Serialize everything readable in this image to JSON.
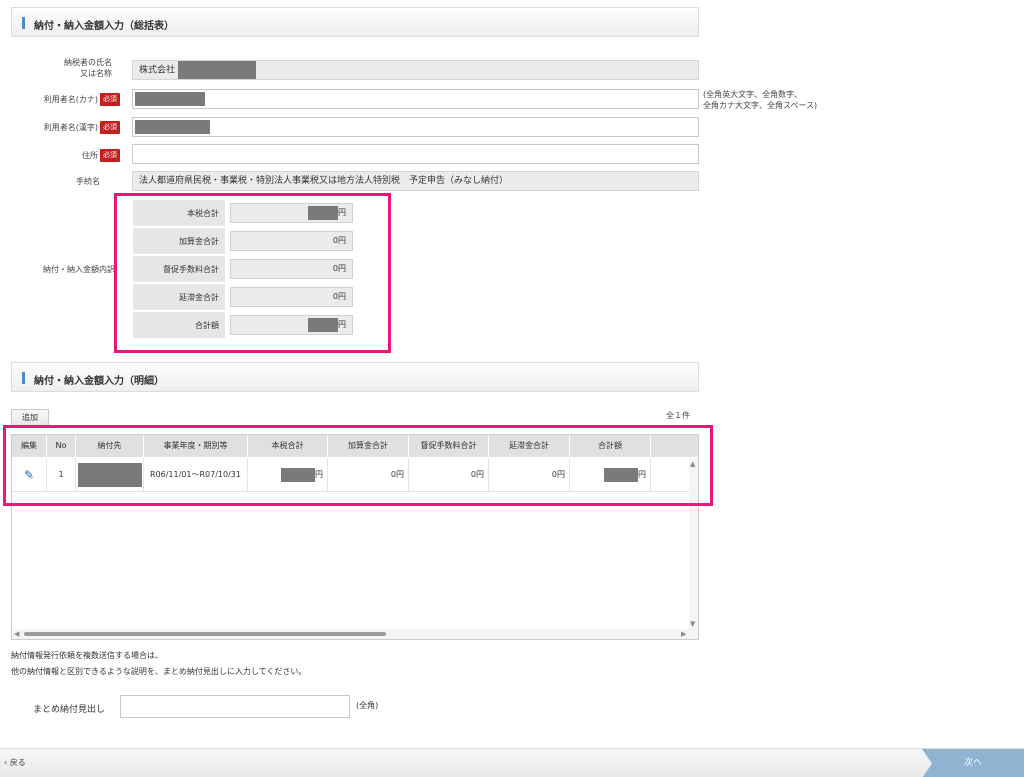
{
  "summary_section": {
    "title": "納付・納入金額入力（総括表）",
    "taxpayer_label": "納税者の氏名\n又は名称",
    "taxpayer_value": "株式会社",
    "user_kana_label": "利用者名(カナ)",
    "user_kanji_label": "利用者名(漢字)",
    "address_label": "住所",
    "required_badge": "必須",
    "kana_note_line1": "(全角英大文字、全角数字、",
    "kana_note_line2": "全角カナ大文字、全角スペース)",
    "procedure_label": "手続名",
    "procedure_value": "法人都道府県民税・事業税・特別法人事業税又は地方法人特別税　予定申告（みなし納付）",
    "breakdown_label": "納付・納入金額内訳",
    "breakdown": [
      {
        "label": "本税合計",
        "value": "円"
      },
      {
        "label": "加算金合計",
        "value": "0円"
      },
      {
        "label": "督促手数料合計",
        "value": "0円"
      },
      {
        "label": "延滞金合計",
        "value": "0円"
      },
      {
        "label": "合計額",
        "value": "円"
      }
    ]
  },
  "detail_section": {
    "title": "納付・納入金額入力（明細）",
    "add_button": "追加",
    "count_text": "全１件",
    "columns": [
      "編集",
      "No",
      "納付先",
      "事業年度・期別等",
      "本税合計",
      "加算金合計",
      "督促手数料合計",
      "延滞金合計",
      "合計額"
    ],
    "rows": [
      {
        "no": "1",
        "period": "R06/11/01～R07/10/31",
        "main_tax": "円",
        "addition": "0円",
        "fee": "0円",
        "delay": "0円",
        "total": "円"
      }
    ],
    "info_line1": "納付情報発行依頼を複数送信する場合は、",
    "info_line2": "他の納付情報と区別できるような説明を、まとめ納付見出しに入力してください。",
    "matome_label": "まとめ納付見出し",
    "matome_note": "(全角)"
  },
  "footer": {
    "back_label": "戻る",
    "next_label": "次へ"
  },
  "colors": {
    "highlight": "#e6197a",
    "required": "#c0201e",
    "next_button": "#8fb3d1"
  }
}
